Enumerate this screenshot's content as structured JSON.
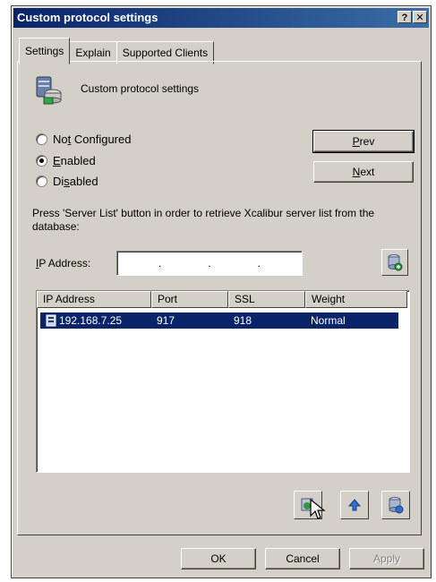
{
  "window": {
    "title": "Custom protocol settings",
    "help_label": "?",
    "close_label": "✕"
  },
  "tabs": [
    {
      "label": "Settings",
      "active": true
    },
    {
      "label": "Explain",
      "active": false
    },
    {
      "label": "Supported Clients",
      "active": false
    }
  ],
  "header": {
    "label": "Custom protocol settings",
    "icon": "server-database-icon"
  },
  "radios": [
    {
      "label_pre": "No",
      "label_ul": "t",
      "label_post": " Configured",
      "checked": false
    },
    {
      "label_pre": "",
      "label_ul": "E",
      "label_post": "nabled",
      "checked": true
    },
    {
      "label_pre": "Di",
      "label_ul": "s",
      "label_post": "abled",
      "checked": false
    }
  ],
  "nav": {
    "prev_ul": "P",
    "prev_rest": "rev",
    "next_ul": "N",
    "next_rest": "ext"
  },
  "description": "Press 'Server List' button in order to retrieve Xcalibur server list from the database:",
  "ip_field": {
    "label_ul": "I",
    "label_rest": "P Address:",
    "dots": [
      ".",
      ".",
      "."
    ]
  },
  "list": {
    "columns": [
      "IP Address",
      "Port",
      "SSL",
      "Weight"
    ],
    "rows": [
      {
        "ip": "192.168.7.25",
        "port": "917",
        "ssl": "918",
        "weight": "Normal",
        "selected": true
      }
    ]
  },
  "footer": {
    "ok_label": "OK",
    "cancel_label": "Cancel",
    "apply_label": "Apply"
  }
}
